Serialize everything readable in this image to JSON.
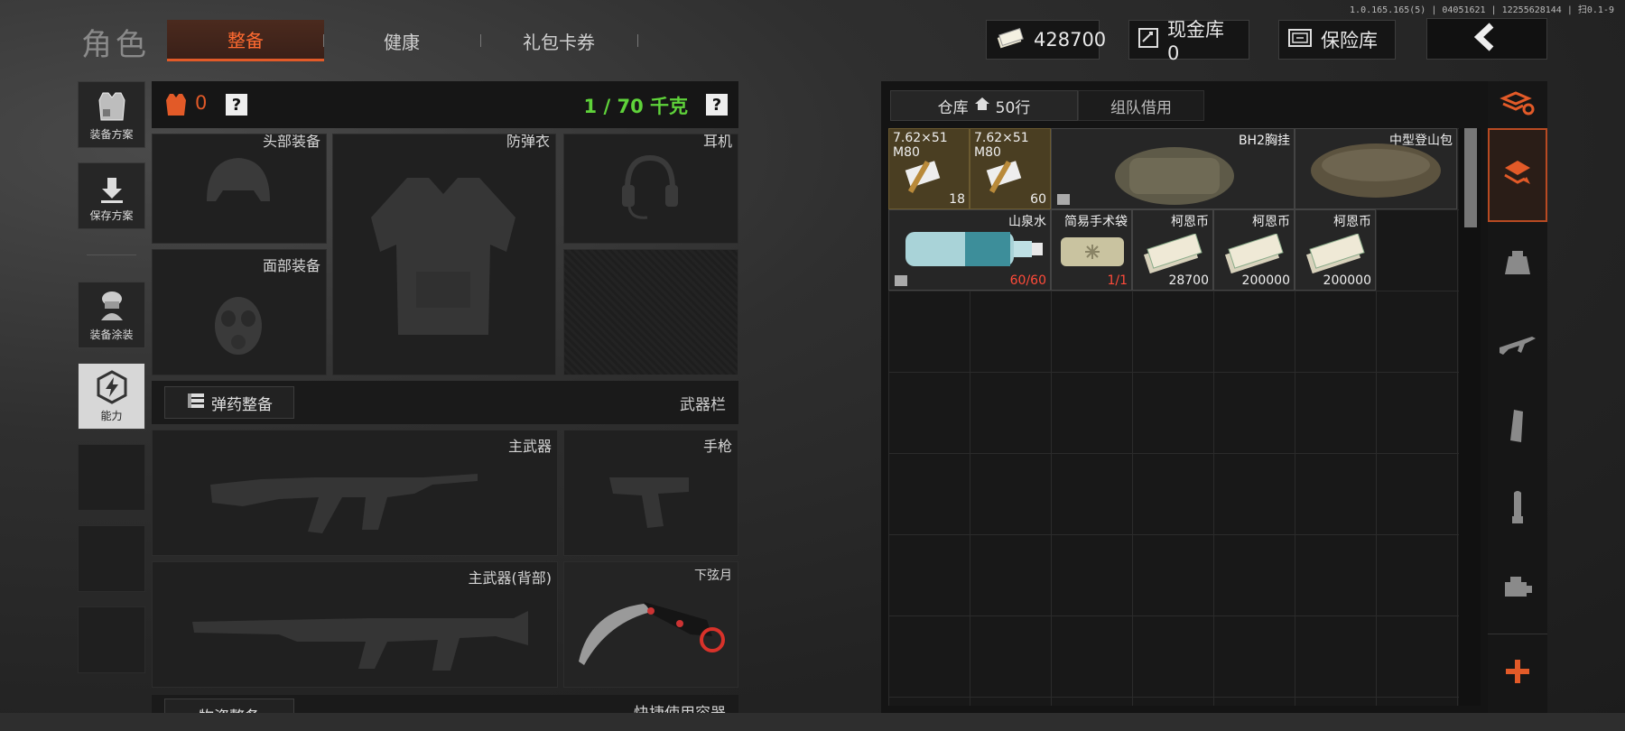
{
  "version": "1.0.165.165(5) | 04051621 | 12255628144 | 扫0.1-9",
  "header": {
    "title": "角色",
    "tabs": [
      {
        "label": "整备",
        "active": true
      },
      {
        "label": "健康",
        "active": false
      },
      {
        "label": "礼包卡券",
        "active": false
      }
    ],
    "money": "428700",
    "cash_vault": "现金库 0",
    "safe_box": "保险库"
  },
  "sidebar": [
    {
      "label": "装备方案",
      "icon": "vest-loadout-icon"
    },
    {
      "label": "保存方案",
      "icon": "download-icon"
    },
    {
      "label": "装备涂装",
      "icon": "soldier-skin-icon"
    },
    {
      "label": "能力",
      "icon": "lightning-hex-icon"
    }
  ],
  "equipment": {
    "armor_count": "0",
    "weight": "1 / 70 千克",
    "help": "?",
    "slots": {
      "head": "头部装备",
      "body_armor": "防弹衣",
      "headset": "耳机",
      "face": "面部装备",
      "primary": "主武器",
      "pistol": "手枪",
      "primary_back": "主武器(背部)",
      "melee": "下弦月"
    },
    "ammo_section_label": "弹药整备",
    "weapons_section_label": "武器栏",
    "supplies_section_label": "物资整备",
    "quick_use_label": "快捷使用容器"
  },
  "stash": {
    "tabs": [
      {
        "label": "仓库",
        "extra": "50行",
        "active": true
      },
      {
        "label": "组队借用",
        "active": false
      }
    ],
    "items": [
      {
        "name": "7.62×51\nM80",
        "count": "18",
        "kind": "ammo"
      },
      {
        "name": "7.62×51\nM80",
        "count": "60",
        "kind": "ammo"
      },
      {
        "name": "BH2胸挂",
        "count": "",
        "kind": "rig"
      },
      {
        "name": "中型登山包",
        "count": "",
        "kind": "backpack"
      },
      {
        "name": "山泉水",
        "count": "60/60",
        "kind": "water"
      },
      {
        "name": "简易手术袋",
        "count": "1/1",
        "kind": "medkit"
      },
      {
        "name": "柯恩币",
        "count": "28700",
        "kind": "cash"
      },
      {
        "name": "柯恩币",
        "count": "200000",
        "kind": "cash"
      },
      {
        "name": "柯恩币",
        "count": "200000",
        "kind": "cash"
      }
    ]
  },
  "filters": [
    "all-items-icon",
    "stash-sort-icon",
    "backpack-icon",
    "rifle-icon",
    "magazine-icon",
    "bullet-icon",
    "attachment-icon",
    "add-icon"
  ],
  "colors": {
    "accent": "#e25a28",
    "weight_ok": "#5fd33a",
    "count_red": "#ff4b3a"
  }
}
